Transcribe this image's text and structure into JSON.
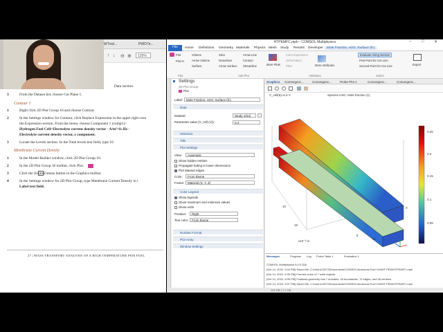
{
  "pdf": {
    "tabs": [
      "WTrod...",
      "PWO7e..."
    ],
    "zoom": "125%",
    "lines": {
      "data_section": "Data section.",
      "step3": "From the Dataset list, choose Cut Plane 1.",
      "contour_heading": "Contour 1",
      "c1": "Right click 2D Plot Group 16 and choose Contour.",
      "c2a": "In the Settings window for Contour, click Replace Expression in the upper right corn",
      "c2b": "the Expression section. From the menu, choose Component 1 (comp1)>",
      "c2c": "Hydrogen Fuel Cell>Electrolyte current density vector - A/m²>fc.IIz -",
      "c2d": "Electrolyte current density vector, z component.",
      "c3": "Locate the Levels section. In the Total levels text field, type 10.",
      "mem_heading": "Membrane Current Density",
      "m1": "In the Model Builder window, click 2D Plot Group 16.",
      "m2": "In the 2D Plot Group 16 toolbar, click     Plot.",
      "m3": "Click the     Zoom Extents button in the Graphics toolbar.",
      "m4a": "In the Settings window for 2D Plot Group, type Membrane Current Density in t",
      "m4b": "Label text field."
    },
    "numbers": [
      "3",
      "1",
      "2",
      "3",
      "1",
      "2",
      "3",
      "4"
    ],
    "footer": "27  |  MASS TRANSPORT ANALYSIS OF A HIGH TEMPERATURE PEM FUEL"
  },
  "comsol": {
    "title": "HTPEMFC.mph - COMSOL Multiphysics",
    "menu": [
      "File",
      "Home",
      "Definitions",
      "Geometry",
      "Materials",
      "Physics",
      "Mesh",
      "Study",
      "Results",
      "Developer",
      "Mole Fraction, H2O, Surface (fc)"
    ],
    "ribbon": {
      "plot": "Plot",
      "plot_in": "Plot In",
      "volume": "Volume",
      "arrow_volume": "Arrow Volume",
      "surface": "Surface",
      "slice": "Slice",
      "isosurface": "Isosurface",
      "arrow_surface": "Arrow Surface",
      "arrow_line": "Arrow Line",
      "contour": "Contour",
      "streamline": "Streamline",
      "more_plots": "More Plots",
      "color_expression": "Color Expression",
      "deformation": "Deformation",
      "filter": "Filter",
      "more_attributes": "More Attributes",
      "evaluate_along_normal": "Evaluate Along Normal",
      "first_point": "First Point for Cut Line",
      "second_point": "Second Point for Cut Line",
      "export": "Export",
      "group_plot": "Plot",
      "group_add_plot": "Add Plot",
      "group_attributes": "Attributes",
      "group_select": "Select"
    },
    "settings": {
      "header": "Settings",
      "sub": "3D Plot Group",
      "plot_btn": "Plot",
      "label_key": "Label:",
      "label_val": "Mole Fraction, H2O, Surface (fc)",
      "data": "Data",
      "dataset_key": "Dataset:",
      "dataset_val": "Study 1/Sol",
      "param_key": "Parameter value (V_cell (V)):",
      "param_val": "0.4",
      "selection": "Selection",
      "title_sec": "Title",
      "plot_settings": "Plot Settings",
      "view_key": "View:",
      "view_val": "Automatic",
      "show_hidden": "Show hidden entities",
      "propagate": "Propagate hiding to lower dimensions",
      "plot_dataset_edges": "Plot dataset edges",
      "color_key": "Color:",
      "color_val": "From theme",
      "frame_key": "Frame:",
      "frame_val": "Material (X, Y, Z)",
      "color_legend": "Color Legend",
      "show_legends": "Show legends",
      "show_maxmin": "Show maximum and minimum values",
      "show_units": "Show units",
      "position_key": "Position:",
      "position_val": "Right",
      "textcolor_key": "Text color:",
      "textcolor_val": "From theme",
      "number_format": "Number Format",
      "plot_array": "Plot Array",
      "window_settings": "Window Settings"
    },
    "graphics": {
      "tabs": [
        "Graphics",
        "Convergenc...",
        "Convergenc...",
        "Probe Plot 1",
        "Convergenc...",
        "Convergenc..."
      ],
      "label_left": "V_cell(8)=0.4 V",
      "label_mid": "Species H2O: Mole fraction (1)",
      "legend_ticks": [
        "0.25",
        "0.2",
        "0.15",
        "0.1",
        "0.05"
      ],
      "axis_x1": "15",
      "axis_x2": "10",
      "axis_x3": "5",
      "axis_unit": "x10⁻³ m",
      "axis_y1": "15",
      "axis_y2": "10",
      "axis_y3": "5",
      "axis_z": "0"
    },
    "messages": {
      "tabs": [
        "Messages",
        "Progress",
        "Log",
        "Probe Table 1",
        "Evaluation 1"
      ],
      "lines": [
        "COMSOL Multiphysics 6.0.0.318",
        "[Oct 14, 2022, 9:04 PM] Saved file: C:\\Users\\13073\\Documents\\COMSOL\\Ammonia Fuel Cell\\HT PEM\\HTPEMFC.mph",
        "[Oct 14, 2022, 9:05 PM] Formed union of 7 solid objects.",
        "[Oct 14, 2022, 9:05 PM] Finalized geometry has 7 domains, 40 boundaries, 72 edges, and 48 vertices.",
        "[Oct 14, 2022, 9:07 PM] Saved file: C:\\Users\\13073\\Documents\\COMSOL\\Ammonia Fuel Cell\\HT PEM\\HTPEMFC.mph"
      ]
    },
    "status": "102 GB | 1.1 GB"
  }
}
